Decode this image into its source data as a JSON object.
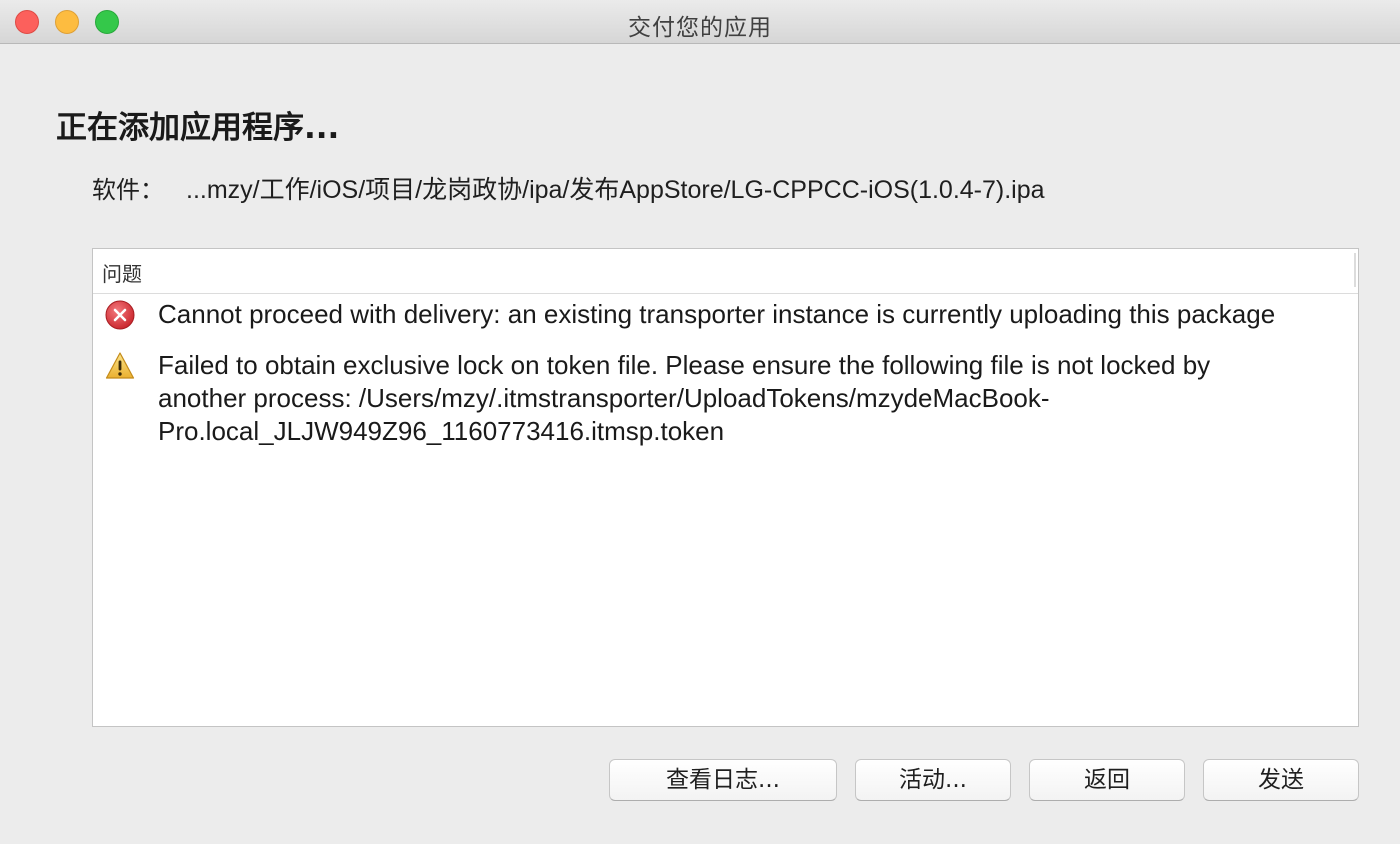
{
  "window": {
    "title": "交付您的应用"
  },
  "header": {
    "heading": "正在添加应用程序...",
    "software_label": "软件：",
    "software_path": "...mzy/工作/iOS/项目/龙岗政协/ipa/发布AppStore/LG-CPPCC-iOS(1.0.4-7).ipa"
  },
  "issues": {
    "column_title": "问题",
    "items": [
      {
        "severity": "error",
        "icon": "error-icon",
        "message": "Cannot proceed with delivery: an existing transporter instance is currently uploading this package"
      },
      {
        "severity": "warning",
        "icon": "warning-icon",
        "message": "Failed to obtain exclusive lock on token file.  Please ensure the following file is not locked by\nanother process: /Users/mzy/.itmstransporter/UploadTokens/mzydeMacBook-\nPro.local_JLJW949Z96_1160773416.itmsp.token"
      }
    ]
  },
  "buttons": {
    "view_log": "查看日志...",
    "activity": "活动...",
    "back": "返回",
    "send": "发送"
  },
  "colors": {
    "close": "#fc605c",
    "minimize": "#fdbc40",
    "maximize": "#34c84a",
    "error": "#e0353c",
    "warning": "#f2c13c"
  }
}
